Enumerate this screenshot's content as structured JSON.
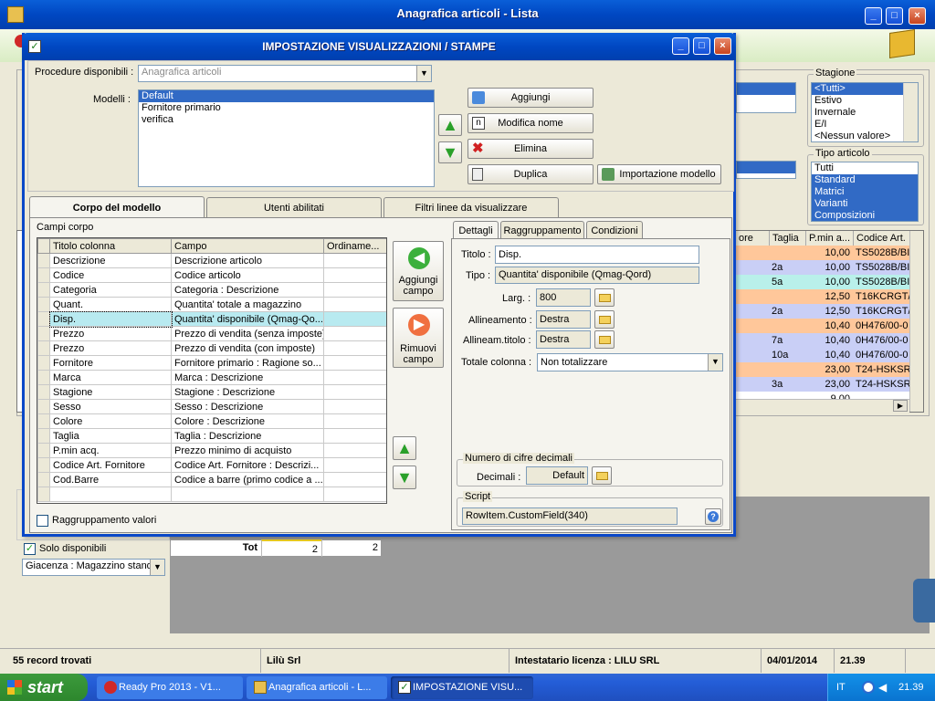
{
  "main_window": {
    "title": "Anagrafica articoli  - Lista"
  },
  "right_panel": {
    "stagione_label": "Stagione",
    "stagione_items": [
      "<Tutti>",
      "Estivo",
      "Invernale",
      "E/I",
      "<Nessun valore>"
    ],
    "tipo_label": "Tipo articolo",
    "tipo_items": [
      "Tutti",
      "Standard",
      "Matrici",
      "Varianti",
      "Composizioni"
    ]
  },
  "bg_grid": {
    "headers": [
      "ore",
      "Taglia",
      "P.min a...",
      "Codice Art."
    ],
    "rows": [
      {
        "taglia": "",
        "pmin": "10,00",
        "codice": "TS5028B/BI",
        "color": "orange"
      },
      {
        "taglia": "2a",
        "pmin": "10,00",
        "codice": "TS5028B/BI",
        "color": "blue"
      },
      {
        "taglia": "5a",
        "pmin": "10,00",
        "codice": "TS5028B/BI",
        "color": "green"
      },
      {
        "taglia": "",
        "pmin": "12,50",
        "codice": "T16KCRGT/(",
        "color": "orange"
      },
      {
        "taglia": "2a",
        "pmin": "12,50",
        "codice": "T16KCRGT/(",
        "color": "blue"
      },
      {
        "taglia": "",
        "pmin": "10,40",
        "codice": "0H476/00-0",
        "color": "orange"
      },
      {
        "taglia": "7a",
        "pmin": "10,40",
        "codice": "0H476/00-0",
        "color": "blue"
      },
      {
        "taglia": "10a",
        "pmin": "10,40",
        "codice": "0H476/00-0",
        "color": "blue"
      },
      {
        "taglia": "",
        "pmin": "23,00",
        "codice": "T24-HSKSR/",
        "color": "orange"
      },
      {
        "taglia": "3a",
        "pmin": "23,00",
        "codice": "T24-HSKSR/",
        "color": "blue"
      },
      {
        "taglia": "",
        "pmin": "9,00",
        "codice": "",
        "color": "white"
      }
    ]
  },
  "bottom_left": {
    "solo_disponibili": "Solo disponibili",
    "giacenza": "Giacenza : Magazzino stand",
    "tot_label": "Tot",
    "tot_val1": "2",
    "tot_val2": "2"
  },
  "dialog": {
    "title": "IMPOSTAZIONE VISUALIZZAZIONI / STAMPE",
    "procedure_label": "Procedure disponibili :",
    "procedure_value": "Anagrafica articoli",
    "modelli_label": "Modelli :",
    "modelli": [
      "Default",
      "Fornitore primario",
      "verifica"
    ],
    "buttons": {
      "aggiungi": "Aggiungi",
      "modifica": "Modifica nome",
      "elimina": "Elimina",
      "duplica": "Duplica",
      "importazione": "Importazione modello"
    },
    "tabs": [
      "Corpo del modello",
      "Utenti abilitati",
      "Filtri linee da visualizzare"
    ],
    "campi_corpo_label": "Campi corpo",
    "grid_headers": [
      "Titolo colonna",
      "Campo",
      "Ordiname..."
    ],
    "grid_rows": [
      {
        "titolo": "Descrizione",
        "campo": "Descrizione articolo"
      },
      {
        "titolo": "Codice",
        "campo": "Codice articolo"
      },
      {
        "titolo": "Categoria",
        "campo": "Categoria : Descrizione"
      },
      {
        "titolo": "Quant.",
        "campo": "Quantita' totale a magazzino"
      },
      {
        "titolo": "Disp.",
        "campo": "Quantita' disponibile (Qmag-Qo..."
      },
      {
        "titolo": "Prezzo",
        "campo": "Prezzo di vendita (senza imposte)"
      },
      {
        "titolo": "Prezzo",
        "campo": "Prezzo di vendita (con imposte)"
      },
      {
        "titolo": "Fornitore",
        "campo": "Fornitore primario : Ragione so..."
      },
      {
        "titolo": "Marca",
        "campo": "Marca : Descrizione"
      },
      {
        "titolo": "Stagione",
        "campo": "Stagione : Descrizione"
      },
      {
        "titolo": "Sesso",
        "campo": "Sesso : Descrizione"
      },
      {
        "titolo": "Colore",
        "campo": "Colore : Descrizione"
      },
      {
        "titolo": "Taglia",
        "campo": "Taglia : Descrizione"
      },
      {
        "titolo": "P.min acq.",
        "campo": "Prezzo minimo di acquisto"
      },
      {
        "titolo": "Codice Art. Fornitore",
        "campo": "Codice Art. Fornitore : Descrizi..."
      },
      {
        "titolo": "Cod.Barre",
        "campo": "Codice a barre (primo codice a ..."
      },
      {
        "titolo": "",
        "campo": ""
      }
    ],
    "aggiungi_campo": "Aggiungi campo",
    "rimuovi_campo": "Rimuovi campo",
    "raggruppamento_valori": "Raggruppamento valori",
    "subtabs": [
      "Dettagli",
      "Raggruppamento",
      "Condizioni"
    ],
    "titolo_label": "Titolo :",
    "titolo_value": "Disp.",
    "tipo_label": "Tipo :",
    "tipo_value": "Quantita' disponibile (Qmag-Qord)",
    "larg_label": "Larg. :",
    "larg_value": "800",
    "allineamento_label": "Allineamento :",
    "allineamento_value": "Destra",
    "allineam_titolo_label": "Allineam.titolo :",
    "allineam_titolo_value": "Destra",
    "totale_label": "Totale colonna :",
    "totale_value": "Non totalizzare",
    "decimali_group": "Numero di cifre decimali",
    "decimali_label": "Decimali :",
    "decimali_value": "Default",
    "script_group": "Script",
    "script_value": "RowItem.CustomField(340)"
  },
  "status_bar": {
    "records": "55 record trovati",
    "company": "Lilù Srl",
    "licenza": "Intestatario licenza : LILU SRL",
    "date": "04/01/2014",
    "time": "21.39"
  },
  "taskbar": {
    "start": "start",
    "items": [
      "Ready Pro 2013 - V1...",
      "Anagrafica articoli - L...",
      "IMPOSTAZIONE VISU..."
    ],
    "lang": "IT",
    "clock": "21.39"
  }
}
